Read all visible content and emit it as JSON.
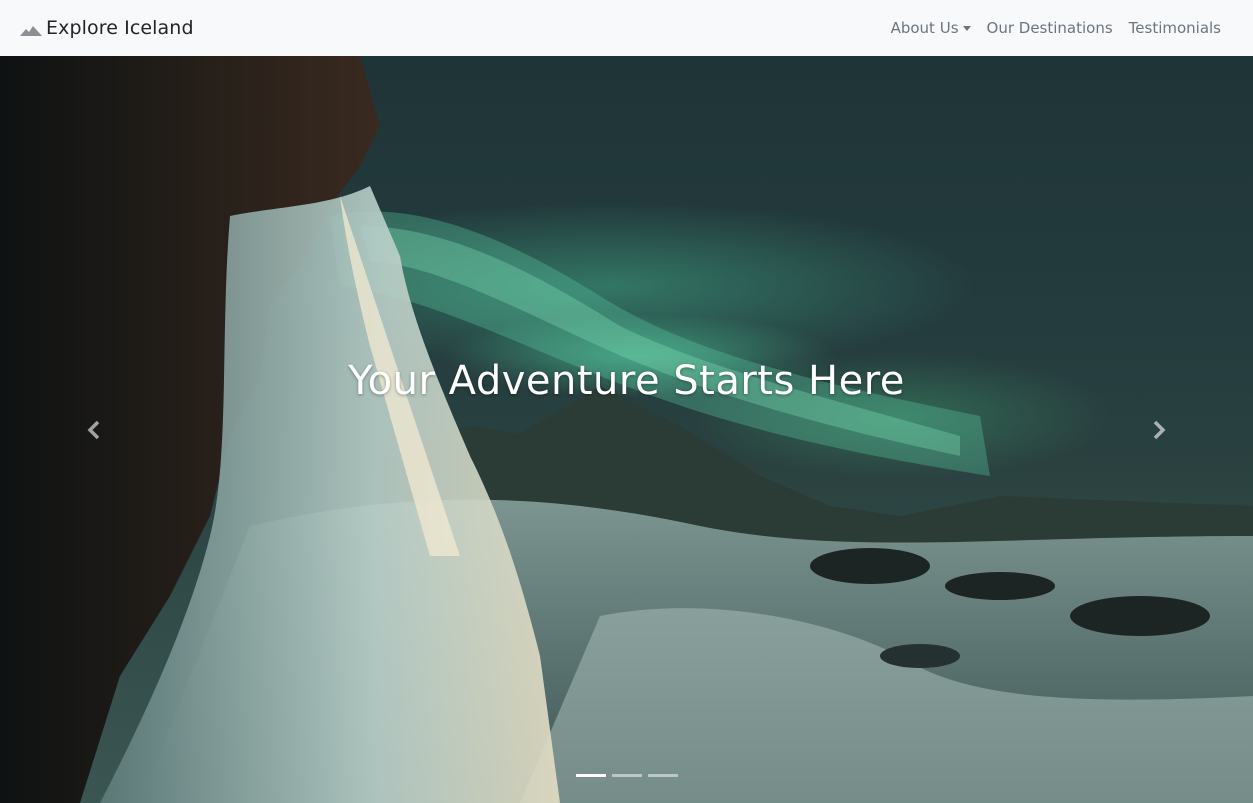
{
  "navbar": {
    "brand": "Explore Iceland",
    "links": [
      {
        "label": "About Us",
        "has_dropdown": true
      },
      {
        "label": "Our Destinations",
        "has_dropdown": false
      },
      {
        "label": "Testimonials",
        "has_dropdown": false
      }
    ]
  },
  "hero": {
    "headline": "Your Adventure Starts Here",
    "slides_count": 3,
    "active_slide": 1
  },
  "icons": {
    "brand": "mountain-icon",
    "prev": "chevron-left-icon",
    "next": "chevron-right-icon"
  },
  "colors": {
    "navbar_bg": "#f8f9fa",
    "brand_text": "#212529",
    "nav_text": "#6c757d",
    "aurora": "#5fd4a8"
  }
}
